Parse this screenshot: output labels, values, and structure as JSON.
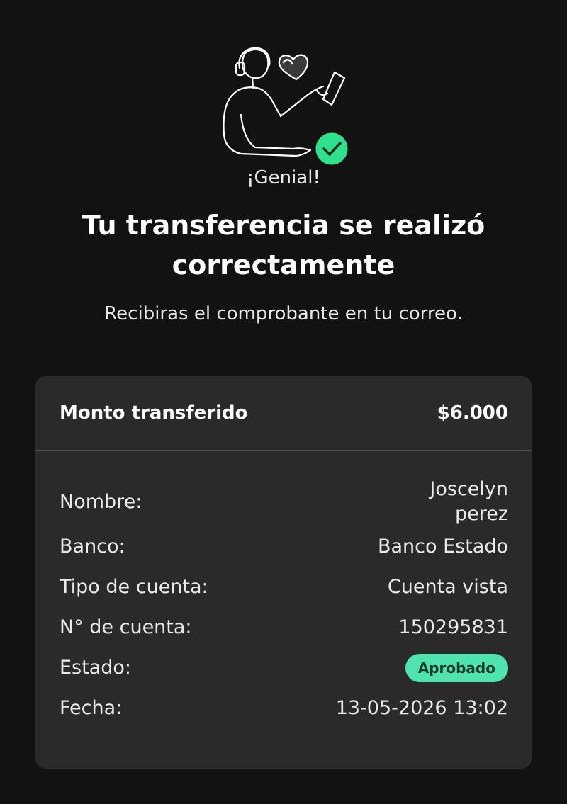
{
  "header": {
    "kicker": "¡Genial!",
    "title": "Tu transferencia se realizó correctamente",
    "subtitle": "Recibiras el comprobante en tu correo."
  },
  "summary": {
    "amount_label": "Monto transferido",
    "amount_value": "$6.000"
  },
  "details": {
    "name_label": "Nombre:",
    "name_value": "Joscelyn perez",
    "bank_label": "Banco:",
    "bank_value": "Banco Estado",
    "account_type_label": "Tipo de cuenta:",
    "account_type_value": "Cuenta vista",
    "account_number_label": "N° de cuenta:",
    "account_number_value": "150295831",
    "status_label": "Estado:",
    "status_value": "Aprobado",
    "date_label": "Fecha:",
    "date_value": "13-05-2026 13:02"
  },
  "colors": {
    "background": "#121212",
    "card": "#2a2a2a",
    "accent": "#4fe3b0",
    "check": "#2fe08c"
  },
  "icons": {
    "hero": "person-with-phone-illustration",
    "success": "check-circle-icon"
  }
}
